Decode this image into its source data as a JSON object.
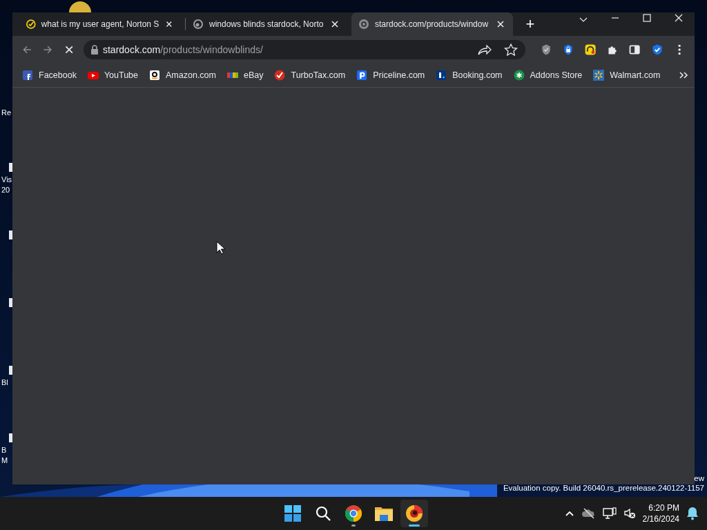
{
  "desktop_icons": [
    {
      "kind": "plain",
      "lines": [
        "Re"
      ]
    },
    {
      "kind": "shortcut",
      "lines": [
        "Vis",
        "20"
      ]
    },
    {
      "kind": "shortcut"
    },
    {
      "kind": "shortcut"
    },
    {
      "kind": "shortcut",
      "lines": [
        "Bl"
      ]
    },
    {
      "kind": "shortcut",
      "lines": [
        "B",
        "M"
      ]
    }
  ],
  "browser": {
    "tabs": [
      {
        "title": "what is my user agent, Norton S",
        "selected": false
      },
      {
        "title": "windows blinds stardock, Norto",
        "selected": false
      },
      {
        "title": "stardock.com/products/window",
        "selected": true
      }
    ],
    "new_tab": "+",
    "loading": true,
    "address": {
      "host": "stardock.com",
      "path": "/products/windowblinds/"
    },
    "bookmarks": [
      {
        "label": "Facebook"
      },
      {
        "label": "YouTube"
      },
      {
        "label": "Amazon.com"
      },
      {
        "label": "eBay"
      },
      {
        "label": "TurboTax.com"
      },
      {
        "label": "Priceline.com"
      },
      {
        "label": "Booking.com"
      },
      {
        "label": "Addons Store"
      },
      {
        "label": "Walmart.com"
      }
    ]
  },
  "watermark": [
    "ew",
    "Evaluation copy. Build 26040.rs_prerelease.240122-1157"
  ],
  "taskbar": {
    "apps": [
      {
        "kind": "start",
        "selected": false,
        "running": false
      },
      {
        "kind": "search",
        "selected": false,
        "running": false
      },
      {
        "kind": "chrome",
        "selected": false,
        "running": true
      },
      {
        "kind": "files",
        "selected": false,
        "running": false
      },
      {
        "kind": "browser",
        "selected": true,
        "running": true
      }
    ],
    "time": "6:20 PM",
    "date": "2/16/2024"
  }
}
